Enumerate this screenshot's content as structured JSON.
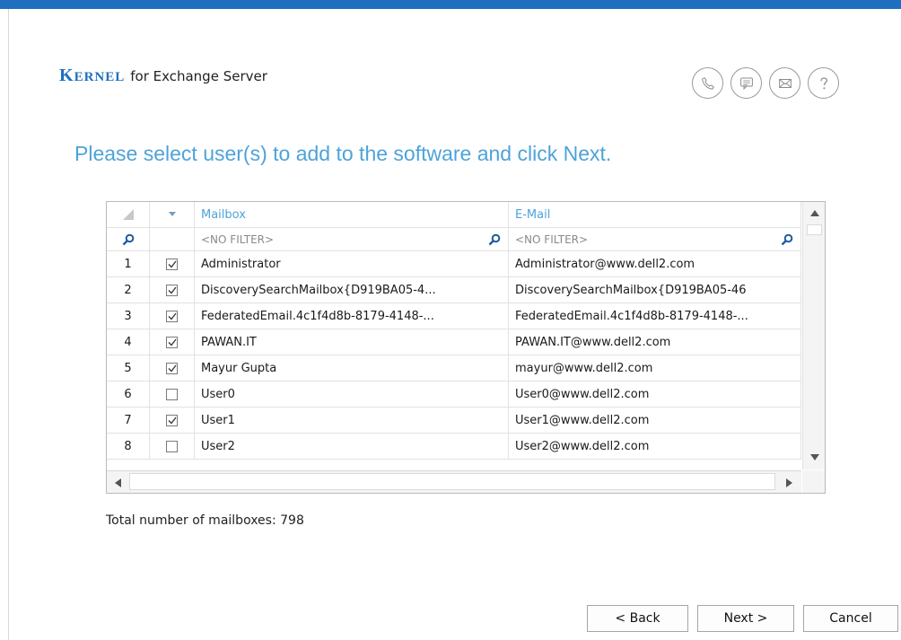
{
  "brand": {
    "kernel_k": "K",
    "kernel_rest": "ERNEL",
    "product": "for Exchange Server"
  },
  "icons": [
    "phone-icon",
    "chat-icon",
    "mail-icon",
    "help-icon"
  ],
  "colors": {
    "accent": "#1e6fbf",
    "heading": "#4ea3d9"
  },
  "heading": "Please select user(s) to add to the software and click Next.",
  "grid": {
    "columns": {
      "mailbox": "Mailbox",
      "email": "E-Mail"
    },
    "filter_placeholder": "<NO FILTER>",
    "rows": [
      {
        "num": "1",
        "checked": true,
        "mailbox": "Administrator",
        "email": "Administrator@www.dell2.com"
      },
      {
        "num": "2",
        "checked": true,
        "mailbox": "DiscoverySearchMailbox{D919BA05-4...",
        "email": "DiscoverySearchMailbox{D919BA05-46"
      },
      {
        "num": "3",
        "checked": true,
        "mailbox": "FederatedEmail.4c1f4d8b-8179-4148-...",
        "email": "FederatedEmail.4c1f4d8b-8179-4148-..."
      },
      {
        "num": "4",
        "checked": true,
        "mailbox": "PAWAN.IT",
        "email": "PAWAN.IT@www.dell2.com"
      },
      {
        "num": "5",
        "checked": true,
        "mailbox": "Mayur Gupta",
        "email": "mayur@www.dell2.com"
      },
      {
        "num": "6",
        "checked": false,
        "mailbox": "User0",
        "email": "User0@www.dell2.com"
      },
      {
        "num": "7",
        "checked": true,
        "mailbox": "User1",
        "email": "User1@www.dell2.com"
      },
      {
        "num": "8",
        "checked": false,
        "mailbox": "User2",
        "email": "User2@www.dell2.com"
      }
    ]
  },
  "total": "Total number of mailboxes: 798",
  "buttons": {
    "back": "< Back",
    "next": "Next >",
    "cancel": "Cancel"
  }
}
